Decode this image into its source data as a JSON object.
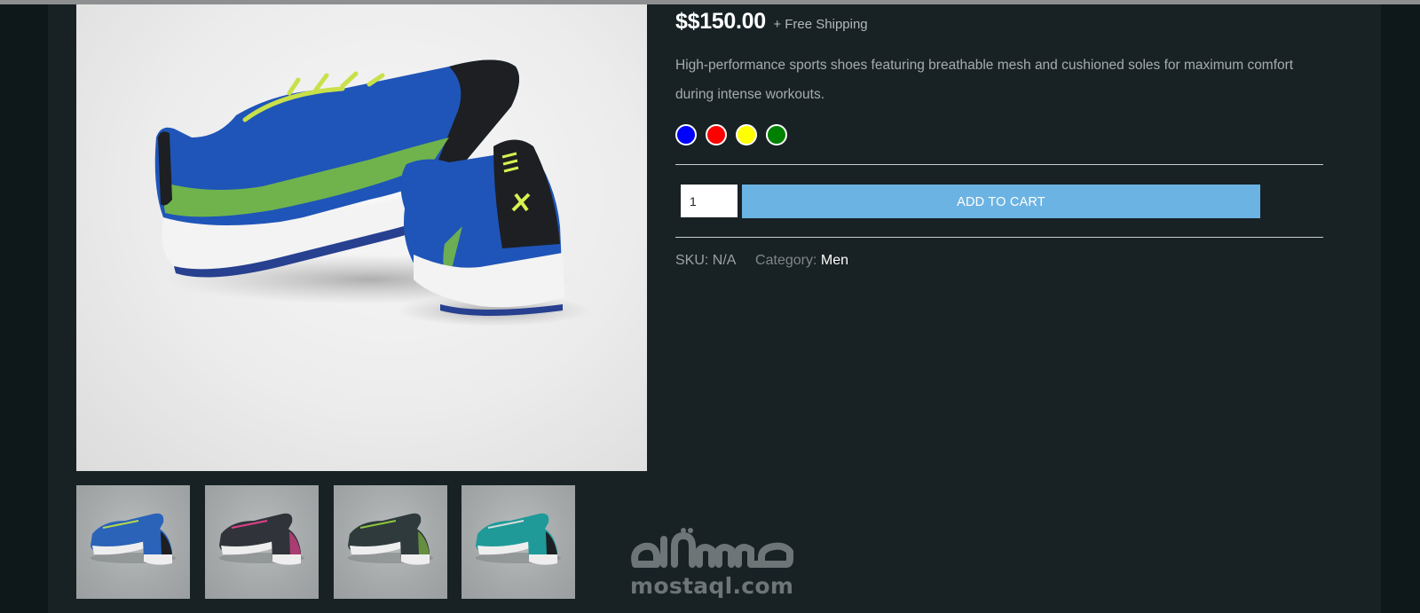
{
  "product": {
    "price": "$$150.00",
    "shipping_note": "+ Free Shipping",
    "description": "High-performance sports shoes featuring breathable mesh and cushioned soles for maximum comfort during intense workouts.",
    "colors": [
      {
        "name": "blue",
        "hex": "#0000ff"
      },
      {
        "name": "red",
        "hex": "#ff0000"
      },
      {
        "name": "yellow",
        "hex": "#ffff00"
      },
      {
        "name": "green",
        "hex": "#008000"
      }
    ],
    "quantity": "1",
    "add_to_cart_label": "ADD TO CART",
    "sku_label": "SKU:",
    "sku_value": "N/A",
    "category_label": "Category:",
    "category_value": "Men"
  },
  "gallery": {
    "main_image": "running-shoes-blue",
    "thumbnails": [
      {
        "name": "shoes-blue-thumbnail",
        "accent": "#2a63b8",
        "lace": "#b8d84a"
      },
      {
        "name": "shoes-pink-thumbnail",
        "accent": "#30343a",
        "lace": "#e0408a"
      },
      {
        "name": "shoes-green-thumbnail",
        "accent": "#2e3a3c",
        "lace": "#8ec63f"
      },
      {
        "name": "shoes-teal-thumbnail",
        "accent": "#1f9a98",
        "lace": "#d5dcdc"
      }
    ]
  },
  "watermark": {
    "arabic": "مستقل",
    "latin": "mostaql.com"
  },
  "colors": {
    "page_bg": "#0e1719",
    "content_bg": "#182225",
    "button_bg": "#6bb3e3"
  }
}
